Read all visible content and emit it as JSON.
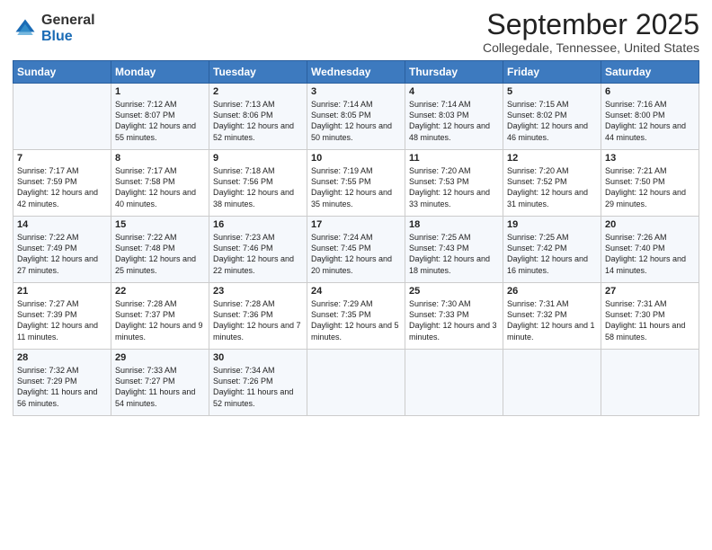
{
  "logo": {
    "general": "General",
    "blue": "Blue"
  },
  "title": "September 2025",
  "subtitle": "Collegedale, Tennessee, United States",
  "days_of_week": [
    "Sunday",
    "Monday",
    "Tuesday",
    "Wednesday",
    "Thursday",
    "Friday",
    "Saturday"
  ],
  "weeks": [
    [
      {
        "day": "",
        "sunrise": "",
        "sunset": "",
        "daylight": ""
      },
      {
        "day": "1",
        "sunrise": "7:12 AM",
        "sunset": "8:07 PM",
        "daylight": "12 hours and 55 minutes."
      },
      {
        "day": "2",
        "sunrise": "7:13 AM",
        "sunset": "8:06 PM",
        "daylight": "12 hours and 52 minutes."
      },
      {
        "day": "3",
        "sunrise": "7:14 AM",
        "sunset": "8:05 PM",
        "daylight": "12 hours and 50 minutes."
      },
      {
        "day": "4",
        "sunrise": "7:14 AM",
        "sunset": "8:03 PM",
        "daylight": "12 hours and 48 minutes."
      },
      {
        "day": "5",
        "sunrise": "7:15 AM",
        "sunset": "8:02 PM",
        "daylight": "12 hours and 46 minutes."
      },
      {
        "day": "6",
        "sunrise": "7:16 AM",
        "sunset": "8:00 PM",
        "daylight": "12 hours and 44 minutes."
      }
    ],
    [
      {
        "day": "7",
        "sunrise": "7:17 AM",
        "sunset": "7:59 PM",
        "daylight": "12 hours and 42 minutes."
      },
      {
        "day": "8",
        "sunrise": "7:17 AM",
        "sunset": "7:58 PM",
        "daylight": "12 hours and 40 minutes."
      },
      {
        "day": "9",
        "sunrise": "7:18 AM",
        "sunset": "7:56 PM",
        "daylight": "12 hours and 38 minutes."
      },
      {
        "day": "10",
        "sunrise": "7:19 AM",
        "sunset": "7:55 PM",
        "daylight": "12 hours and 35 minutes."
      },
      {
        "day": "11",
        "sunrise": "7:20 AM",
        "sunset": "7:53 PM",
        "daylight": "12 hours and 33 minutes."
      },
      {
        "day": "12",
        "sunrise": "7:20 AM",
        "sunset": "7:52 PM",
        "daylight": "12 hours and 31 minutes."
      },
      {
        "day": "13",
        "sunrise": "7:21 AM",
        "sunset": "7:50 PM",
        "daylight": "12 hours and 29 minutes."
      }
    ],
    [
      {
        "day": "14",
        "sunrise": "7:22 AM",
        "sunset": "7:49 PM",
        "daylight": "12 hours and 27 minutes."
      },
      {
        "day": "15",
        "sunrise": "7:22 AM",
        "sunset": "7:48 PM",
        "daylight": "12 hours and 25 minutes."
      },
      {
        "day": "16",
        "sunrise": "7:23 AM",
        "sunset": "7:46 PM",
        "daylight": "12 hours and 22 minutes."
      },
      {
        "day": "17",
        "sunrise": "7:24 AM",
        "sunset": "7:45 PM",
        "daylight": "12 hours and 20 minutes."
      },
      {
        "day": "18",
        "sunrise": "7:25 AM",
        "sunset": "7:43 PM",
        "daylight": "12 hours and 18 minutes."
      },
      {
        "day": "19",
        "sunrise": "7:25 AM",
        "sunset": "7:42 PM",
        "daylight": "12 hours and 16 minutes."
      },
      {
        "day": "20",
        "sunrise": "7:26 AM",
        "sunset": "7:40 PM",
        "daylight": "12 hours and 14 minutes."
      }
    ],
    [
      {
        "day": "21",
        "sunrise": "7:27 AM",
        "sunset": "7:39 PM",
        "daylight": "12 hours and 11 minutes."
      },
      {
        "day": "22",
        "sunrise": "7:28 AM",
        "sunset": "7:37 PM",
        "daylight": "12 hours and 9 minutes."
      },
      {
        "day": "23",
        "sunrise": "7:28 AM",
        "sunset": "7:36 PM",
        "daylight": "12 hours and 7 minutes."
      },
      {
        "day": "24",
        "sunrise": "7:29 AM",
        "sunset": "7:35 PM",
        "daylight": "12 hours and 5 minutes."
      },
      {
        "day": "25",
        "sunrise": "7:30 AM",
        "sunset": "7:33 PM",
        "daylight": "12 hours and 3 minutes."
      },
      {
        "day": "26",
        "sunrise": "7:31 AM",
        "sunset": "7:32 PM",
        "daylight": "12 hours and 1 minute."
      },
      {
        "day": "27",
        "sunrise": "7:31 AM",
        "sunset": "7:30 PM",
        "daylight": "11 hours and 58 minutes."
      }
    ],
    [
      {
        "day": "28",
        "sunrise": "7:32 AM",
        "sunset": "7:29 PM",
        "daylight": "11 hours and 56 minutes."
      },
      {
        "day": "29",
        "sunrise": "7:33 AM",
        "sunset": "7:27 PM",
        "daylight": "11 hours and 54 minutes."
      },
      {
        "day": "30",
        "sunrise": "7:34 AM",
        "sunset": "7:26 PM",
        "daylight": "11 hours and 52 minutes."
      },
      {
        "day": "",
        "sunrise": "",
        "sunset": "",
        "daylight": ""
      },
      {
        "day": "",
        "sunrise": "",
        "sunset": "",
        "daylight": ""
      },
      {
        "day": "",
        "sunrise": "",
        "sunset": "",
        "daylight": ""
      },
      {
        "day": "",
        "sunrise": "",
        "sunset": "",
        "daylight": ""
      }
    ]
  ]
}
